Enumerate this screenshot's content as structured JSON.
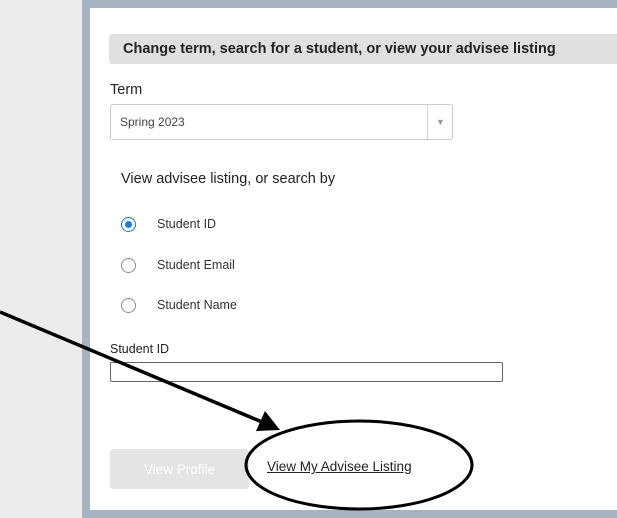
{
  "header": {
    "title": "Change term, search for a student, or view your advisee listing"
  },
  "term": {
    "label": "Term",
    "selected": "Spring 2023"
  },
  "search": {
    "heading": "View advisee listing, or search by",
    "options": [
      {
        "label": "Student ID",
        "checked": true
      },
      {
        "label": "Student Email",
        "checked": false
      },
      {
        "label": "Student Name",
        "checked": false
      }
    ]
  },
  "student_id": {
    "label": "Student ID",
    "value": ""
  },
  "actions": {
    "view_profile": "View Profile",
    "advisee_listing": "View My Advisee Listing"
  },
  "colors": {
    "accent": "#1e7bd8",
    "frame": "#a7b3c2",
    "annotation": "#000000"
  },
  "icons": {
    "dropdown": "chevron-down-icon",
    "annotation_arrow": "arrow-icon",
    "annotation_circle": "highlight-ellipse"
  }
}
